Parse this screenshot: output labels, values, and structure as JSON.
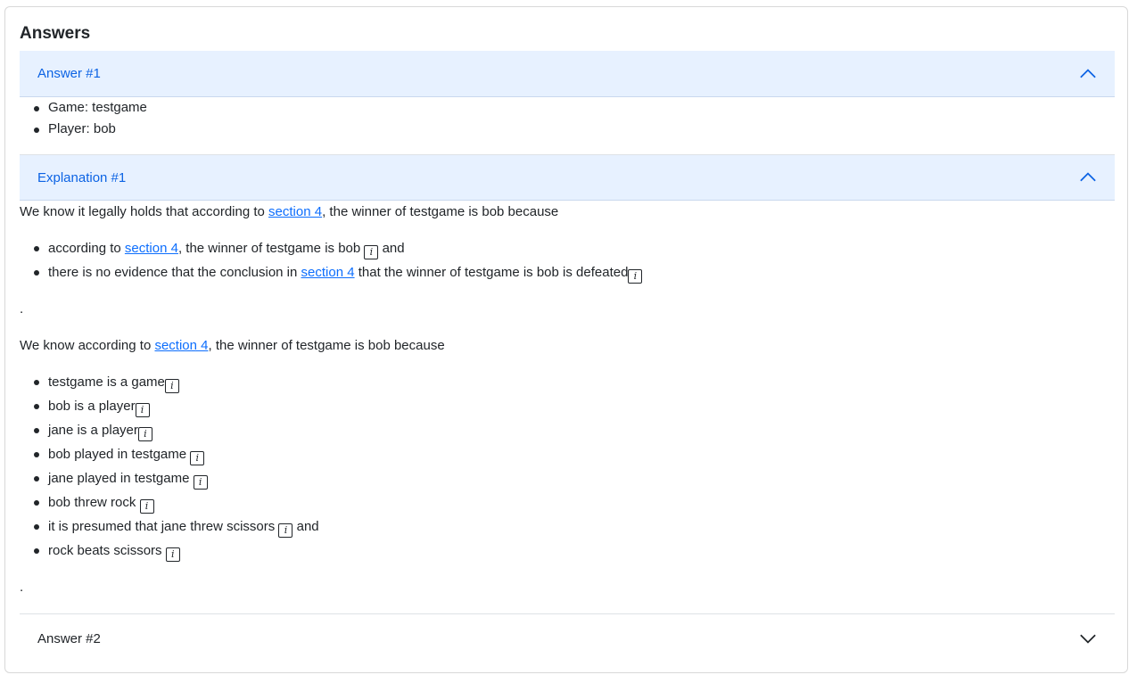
{
  "card": {
    "title": "Answers"
  },
  "answer1": {
    "header": "Answer #1",
    "items": [
      {
        "text": "Game: testgame"
      },
      {
        "text": "Player: bob"
      }
    ]
  },
  "explanation1": {
    "header": "Explanation #1",
    "para1": {
      "before": "We know it legally holds that according to ",
      "link": "section 4",
      "after": ", the winner of testgame is bob because"
    },
    "list1": [
      {
        "before": "according to ",
        "link": "section 4",
        "after": ", the winner of testgame is bob",
        "suffix": "and"
      },
      {
        "before": "there is no evidence that the conclusion in ",
        "link": "section 4",
        "after": " that the winner of testgame is bob is defeated",
        "suffix": ""
      }
    ],
    "period1": ".",
    "para2": {
      "before": "We know according to ",
      "link": "section 4",
      "after": ", the winner of testgame is bob because"
    },
    "list2": [
      {
        "text": "testgame is a game",
        "suffix": ""
      },
      {
        "text": "bob is a player",
        "suffix": ""
      },
      {
        "text": "jane is a player",
        "suffix": ""
      },
      {
        "text": "bob played in testgame",
        "suffix": ""
      },
      {
        "text": "jane played in testgame",
        "suffix": ""
      },
      {
        "text": "bob threw rock",
        "suffix": ""
      },
      {
        "text": "it is presumed that jane threw scissors",
        "suffix": "and"
      },
      {
        "text": "rock beats scissors",
        "suffix": ""
      }
    ],
    "period2": "."
  },
  "answer2": {
    "header": "Answer #2"
  },
  "icons": {
    "info_glyph": "i",
    "chevron_up": "chevron-up-icon",
    "chevron_down": "chevron-down-icon",
    "info": "info-icon"
  },
  "colors": {
    "accordion_active_bg": "#e7f1ff",
    "accordion_active_text": "#0c63e4",
    "link": "#0d6efd"
  }
}
